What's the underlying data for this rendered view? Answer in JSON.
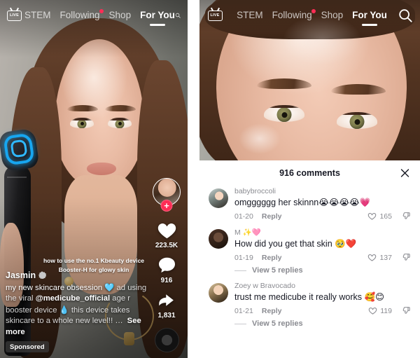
{
  "nav": {
    "live_label": "LIVE",
    "items": [
      {
        "label": "STEM",
        "active": false,
        "dot": false
      },
      {
        "label": "Following",
        "active": false,
        "dot": true
      },
      {
        "label": "Shop",
        "active": false,
        "dot": false
      },
      {
        "label": "For You",
        "active": true,
        "dot": false
      }
    ],
    "search_icon": "search-icon"
  },
  "left_panel": {
    "overlay_text": "how to use the no.1 Kbeauty device Booster-H for glowy skin",
    "author": "Jasmin",
    "caption_part1": "my new skincare obsession ",
    "caption_emoji1": "🩵",
    "caption_part2": " ad using the viral ",
    "caption_mention": "@medicube_official",
    "caption_part3": " age r booster device ",
    "caption_emoji2": "💧",
    "caption_part4": " this device takes skincare to a whole new level!! …",
    "see_more": "See more",
    "sponsored": "Sponsored",
    "rail": {
      "follow_plus": "+",
      "like_count": "223.5K",
      "comment_count": "916",
      "share_count": "1,831"
    }
  },
  "right_panel": {
    "sheet_title": "916 comments",
    "close_icon": "close-icon",
    "comments": [
      {
        "username": "babybroccoli",
        "text": "omgggggg her skinnn",
        "emoji": "😭😭😭😭💗",
        "date": "01-20",
        "reply": "Reply",
        "likes": "165",
        "view_replies": null
      },
      {
        "username": "M ✨🩷",
        "text": "How did you get that skin ",
        "emoji": "🥹❤️",
        "date": "01-19",
        "reply": "Reply",
        "likes": "137",
        "view_replies": "View 5 replies"
      },
      {
        "username": "Zoey w Bravocado",
        "text": "trust me medicube it really works ",
        "emoji": "🥰😊",
        "date": "01-21",
        "reply": "Reply",
        "likes": "119",
        "view_replies": "View 5 replies"
      }
    ]
  },
  "colors": {
    "accent_red": "#fe2c55",
    "text_dark": "#161823",
    "text_muted": "#8a8b91"
  }
}
